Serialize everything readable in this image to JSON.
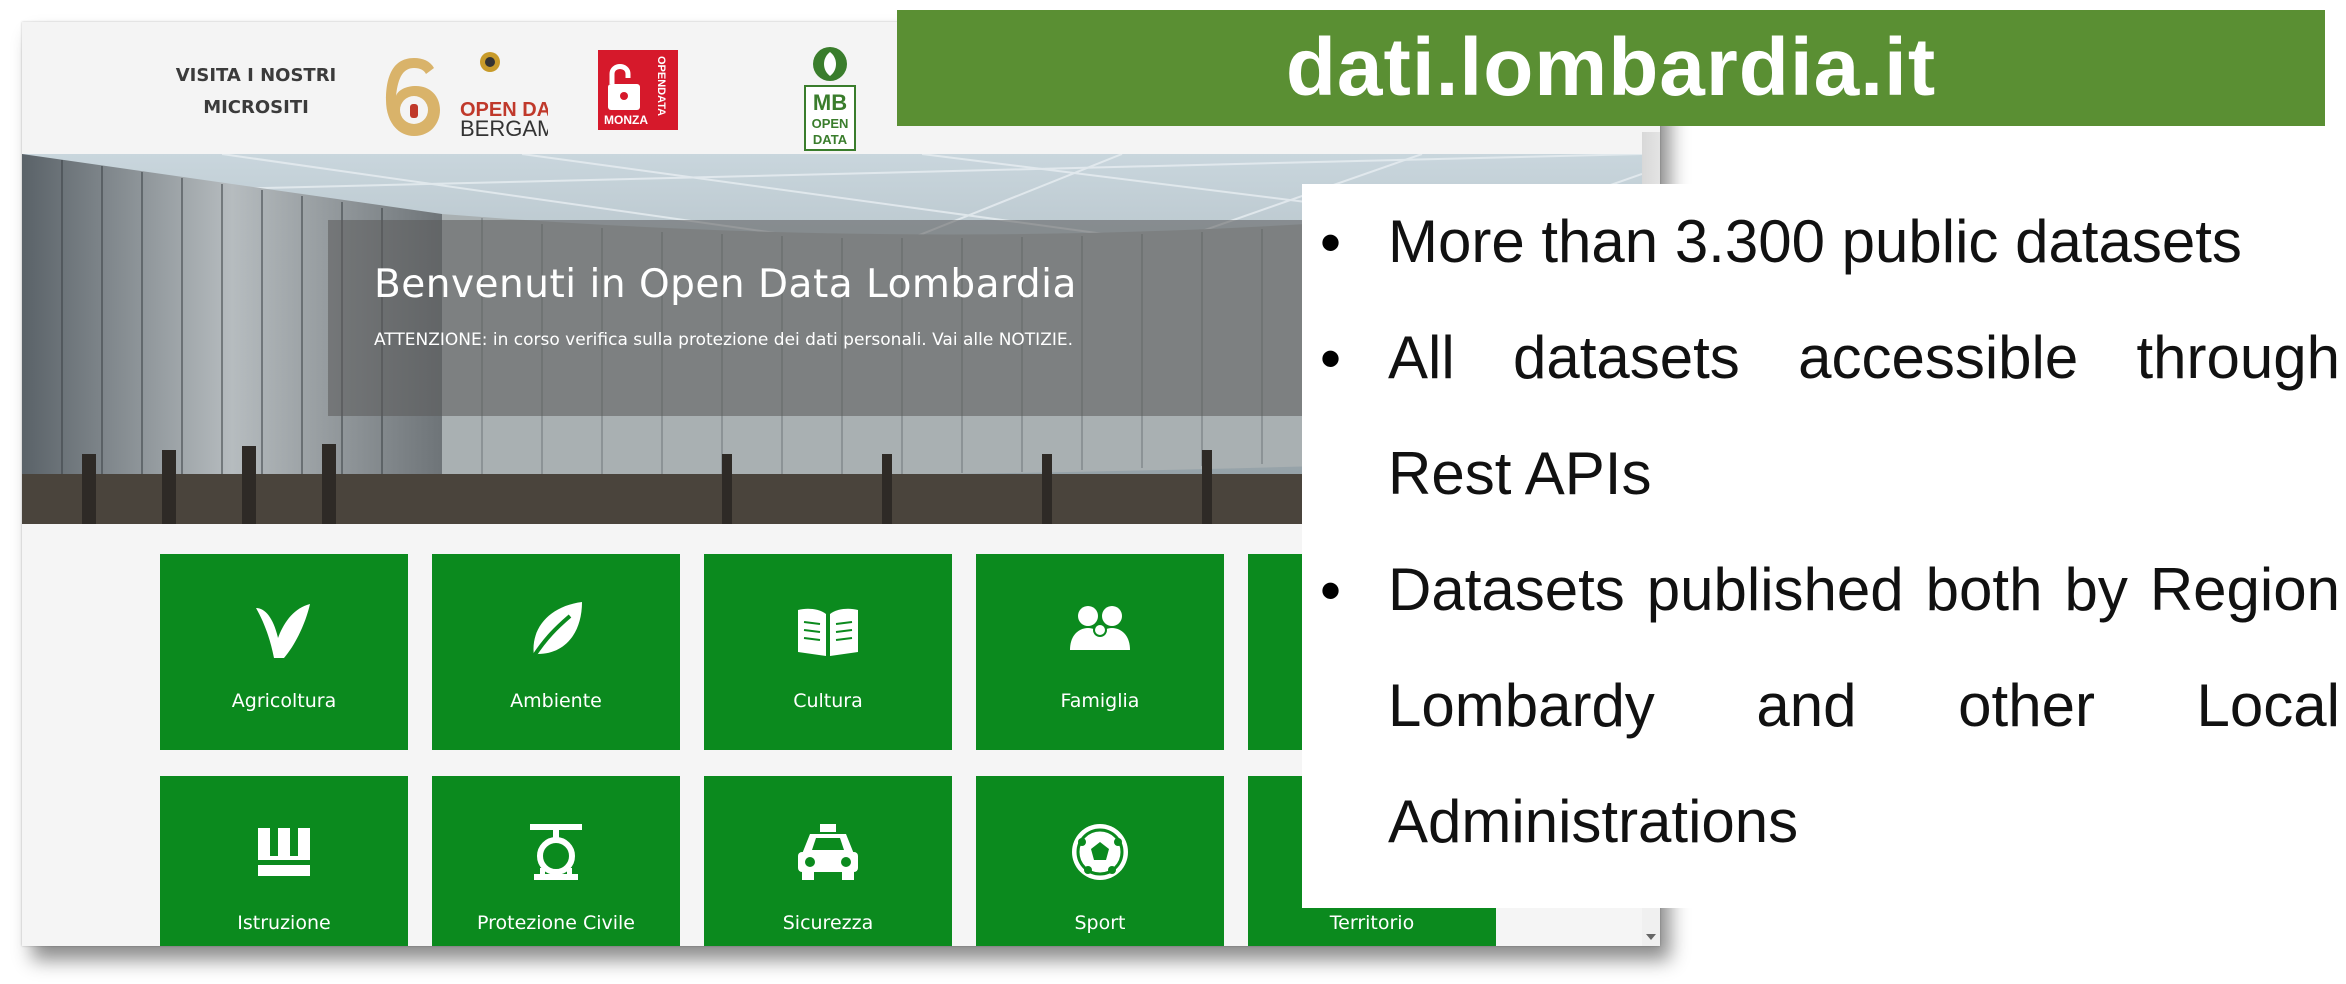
{
  "microsites": {
    "label": "VISITA I NOSTRI\nMICROSITI",
    "logos": [
      {
        "name": "open-data-bergamo",
        "line1": "OPEN DATA",
        "line2": "BERGAMO"
      },
      {
        "name": "monza-opendata",
        "line1": "MONZA",
        "line2": "OPENDATA"
      },
      {
        "name": "mb-open-data",
        "line1": "MB",
        "line2": "OPEN",
        "line3": "DATA"
      }
    ]
  },
  "hero": {
    "title": "Benvenuti in Open Data Lombardia",
    "subtitle": "ATTENZIONE: in corso verifica sulla protezione dei dati personali. Vai alle NOTIZIE."
  },
  "tiles": [
    {
      "label": "Agricoltura",
      "icon": "agricoltura-icon"
    },
    {
      "label": "Ambiente",
      "icon": "leaf-icon"
    },
    {
      "label": "Cultura",
      "icon": "book-icon"
    },
    {
      "label": "Famiglia",
      "icon": "family-icon"
    },
    {
      "label": "",
      "icon": ""
    },
    {
      "label": "Istruzione",
      "icon": "istruzione-icon"
    },
    {
      "label": "Protezione Civile",
      "icon": "protezione-civile-icon"
    },
    {
      "label": "Sicurezza",
      "icon": "car-icon"
    },
    {
      "label": "Sport",
      "icon": "ball-icon"
    },
    {
      "label": "Territorio",
      "icon": ""
    }
  ],
  "slide": {
    "title": "dati.lombardia.it",
    "bullets": [
      {
        "text": "More than 3.300 public datasets"
      },
      {
        "text": "All datasets accessible through Rest APIs"
      },
      {
        "text": "Datasets published both by Region Lombardy and other Local Administrations"
      }
    ]
  },
  "colors": {
    "tile_green": "#0b8a1e",
    "banner_green": "#5a8f33",
    "monza_red": "#d6192b",
    "bergamo_gold": "#d9b36a"
  }
}
